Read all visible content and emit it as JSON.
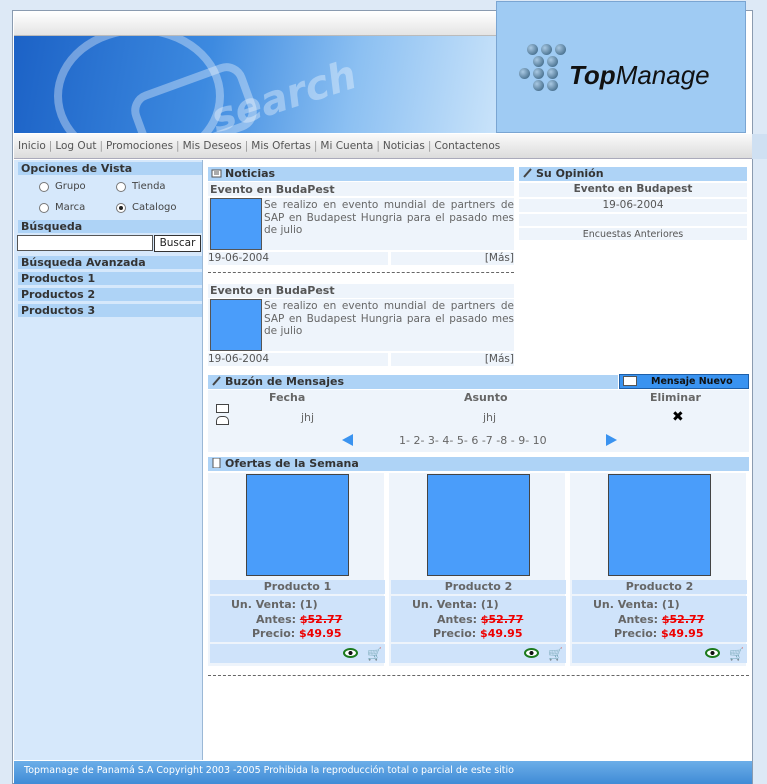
{
  "brand": {
    "logo_word1": "Top",
    "logo_word2": "Manage",
    "banner_word": "search"
  },
  "nav": [
    "Inicio",
    "Log Out",
    "Promociones",
    "Mis Deseos",
    "Mis Ofertas",
    "Mi Cuenta",
    "Noticias",
    "Contactenos"
  ],
  "sidebar": {
    "view_title": "Opciones de Vista",
    "options": [
      {
        "label": "Grupo",
        "selected": false
      },
      {
        "label": "Tienda",
        "selected": false
      },
      {
        "label": "Marca",
        "selected": false
      },
      {
        "label": "Catalogo",
        "selected": true
      }
    ],
    "search_title": "Búsqueda",
    "search_value": "",
    "search_button": "Buscar",
    "links": [
      "Búsqueda Avanzada",
      "Productos 1",
      "Productos 2",
      "Productos 3"
    ]
  },
  "news": {
    "title": "Noticias",
    "items": [
      {
        "headline": "Evento en BudaPest",
        "text": "Se realizo en evento mundial de partners de SAP en Budapest Hungria para el pasado mes de julio",
        "date": "19-06-2004",
        "more": "[Más]"
      },
      {
        "headline": "Evento en BudaPest",
        "text": "Se realizo en evento mundial de partners de SAP en Budapest Hungria para el pasado mes de julio",
        "date": "19-06-2004",
        "more": "[Más]"
      }
    ]
  },
  "opinion": {
    "title": "Su Opinión",
    "headline": "Evento en Budapest",
    "date": "19-06-2004",
    "previous": "Encuestas Anteriores"
  },
  "messages": {
    "title": "Buzón de Mensajes",
    "new_button": "Mensaje Nuevo",
    "headers": [
      "Fecha",
      "Asunto",
      "Eliminar"
    ],
    "row": {
      "fecha": "jhj",
      "asunto": "jhj",
      "delete_glyph": "✖"
    },
    "pages": "1- 2- 3- 4- 5- 6 -7 -8 - 9- 10"
  },
  "offers": {
    "title": "Ofertas de la Semana",
    "unit_label": "Un. Venta:",
    "before_label": "Antes:",
    "price_label": "Precio:",
    "products": [
      {
        "name": "Producto 1",
        "unit": "(1)",
        "before": "$52.77",
        "price": "$49.95"
      },
      {
        "name": "Producto 2",
        "unit": "(1)",
        "before": "$52.77",
        "price": "$49.95"
      },
      {
        "name": "Producto 2",
        "unit": "(1)",
        "before": "$52.77",
        "price": "$49.95"
      }
    ]
  },
  "footer": "Topmanage de Panamá S.A Copyright 2003 -2005 Prohibida la reproducción total o parcial de este sitio",
  "colors": {
    "accent": "#4a9dfa",
    "header_blue": "#aed3f6",
    "price_red": "#e00000"
  }
}
